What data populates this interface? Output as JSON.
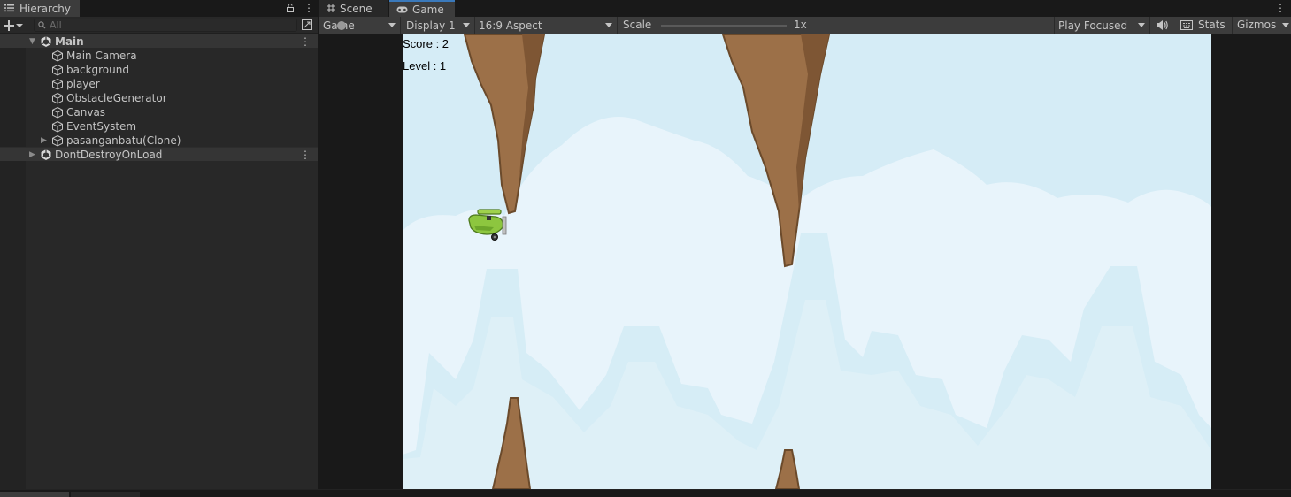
{
  "hierarchy": {
    "tab_label": "Hierarchy",
    "search_placeholder": "All",
    "rows": [
      {
        "label": "Main",
        "kind": "scene",
        "expanded": true
      },
      {
        "label": "Main Camera",
        "kind": "object"
      },
      {
        "label": "background",
        "kind": "object"
      },
      {
        "label": "player",
        "kind": "object"
      },
      {
        "label": "ObstacleGenerator",
        "kind": "object"
      },
      {
        "label": "Canvas",
        "kind": "object"
      },
      {
        "label": "EventSystem",
        "kind": "object"
      },
      {
        "label": "pasanganbatu(Clone)",
        "kind": "object",
        "has_children": true
      },
      {
        "label": "DontDestroyOnLoad",
        "kind": "scene",
        "expanded": false
      }
    ]
  },
  "game_view": {
    "tabs": [
      {
        "label": "Scene",
        "icon": "grid-icon",
        "active": false
      },
      {
        "label": "Game",
        "icon": "gamepad-icon",
        "active": true
      }
    ],
    "toolbar": {
      "view_mode": "Game",
      "display": "Display 1",
      "aspect": "16:9 Aspect",
      "scale_label": "Scale",
      "scale_value": "1x",
      "play_mode": "Play Focused",
      "stats_label": "Stats",
      "gizmos_label": "Gizmos"
    },
    "hud": {
      "score_text": "Score : 2",
      "level_text": "Level : 1"
    }
  },
  "colors": {
    "editor_bg": "#191919",
    "panel_bg": "#282828",
    "active_tab": "#3c3c3c",
    "sky": "#d5ecf6",
    "cloud": "#e8f4fb",
    "rock": "#9c7048",
    "rock_outline": "#6b4a2b",
    "plane": "#8dc63f"
  }
}
